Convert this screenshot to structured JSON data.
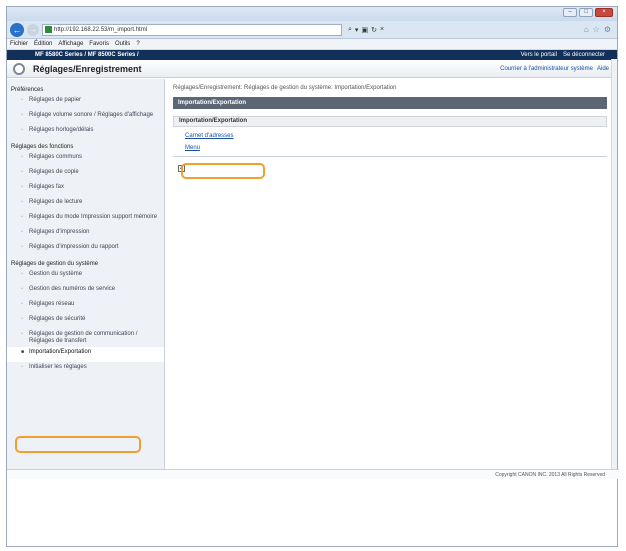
{
  "browser": {
    "url": "http://192.168.22.53/m_import.html",
    "url_tools": [
      "⌕",
      "▾",
      "▣",
      "↻",
      "×"
    ],
    "ie_icons": [
      "⌂",
      "☆",
      "⚙"
    ],
    "window_buttons": [
      "–",
      "□",
      "×"
    ],
    "menu": [
      "Fichier",
      "Édition",
      "Affichage",
      "Favoris",
      "Outils",
      "?"
    ]
  },
  "devicebar": {
    "device": "MF 8580C Series / MF 8500C Series /",
    "links": [
      "Vers le portail",
      "Se déconnecter"
    ]
  },
  "header": {
    "title": "Réglages/Enregistrement",
    "links": [
      "Courrier à l'administrateur système",
      "Aide"
    ]
  },
  "sidebar": {
    "cat_preferences": "Préférences",
    "item_paper": "Réglages de papier",
    "item_volume": "Réglage volume sonore / Réglages d'affichage",
    "item_clock": "Réglages horloge/délais",
    "cat_functions": "Réglages des fonctions",
    "item_common": "Réglages communs",
    "item_copy": "Réglages de copie",
    "item_fax": "Réglages fax",
    "item_read": "Réglages de lecture",
    "item_memory": "Réglages du mode Impression support mémoire",
    "item_print": "Réglages d'impression",
    "item_report": "Réglages d'impression du rapport",
    "cat_system": "Réglages de gestion du système",
    "item_sysmgmt": "Gestion du système",
    "item_dept": "Gestion des numéros de service",
    "item_network": "Réglages réseau",
    "item_security": "Réglages de sécurité",
    "item_comm": "Réglages de gestion de communication / Réglages de transfert",
    "item_import": "Importation/Exportation",
    "item_init": "Initialiser les réglages"
  },
  "main": {
    "breadcrumb": "Réglages/Enregistrement: Réglages de gestion du système: Importation/Exportation",
    "section_title": "Importation/Exportation",
    "sub_title": "Importation/Exportation",
    "link_address_book": "Carnet d'adresses",
    "link_menu": "Menu",
    "top_icon": "▲"
  },
  "footer": {
    "copyright": "Copyright CANON INC. 2013 All Rights Reserved"
  },
  "colors": {
    "highlight": "#f0a030",
    "device_bar": "#11305a",
    "section_title_bg": "#5c6675"
  }
}
